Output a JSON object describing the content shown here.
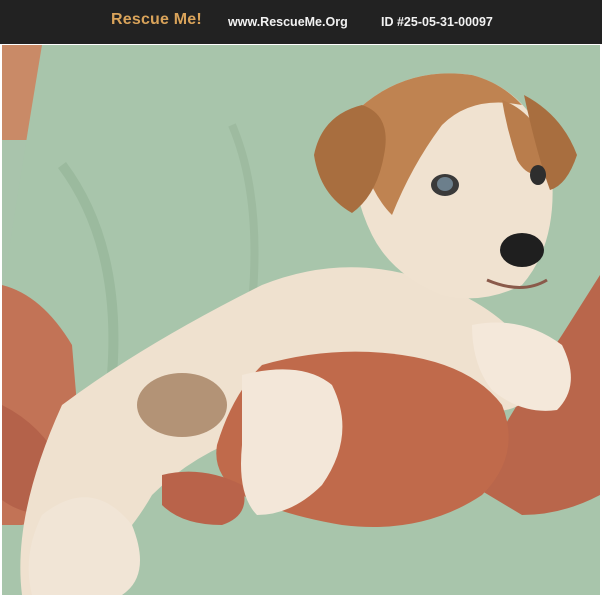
{
  "banner": {
    "brand": "Rescue Me!",
    "site": "www.RescueMe.Org",
    "listing_id": "ID #25-05-31-00097"
  },
  "photo": {
    "subject": "puppy",
    "colors": {
      "banner_bg": "#222222",
      "brand_text": "#d9a35a",
      "shirt": "#a9c4ac",
      "fur_cream": "#efe1cf",
      "fur_tan": "#b9804e",
      "skin": "#c06a4b"
    }
  }
}
